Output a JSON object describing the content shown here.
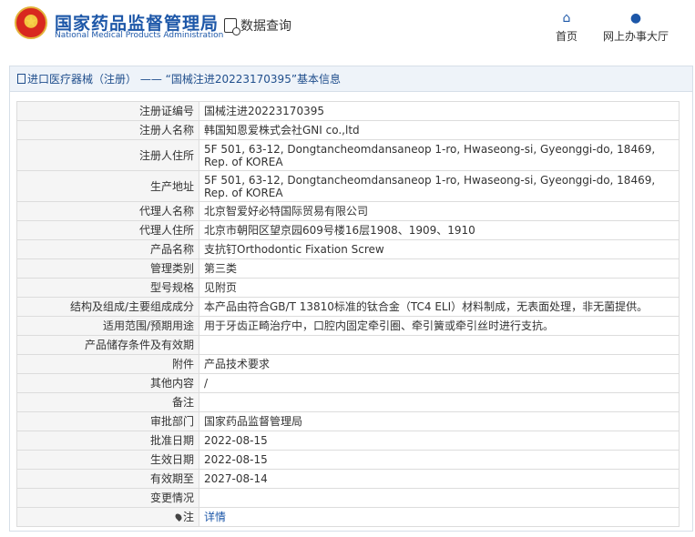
{
  "header": {
    "brand_cn": "国家药品监督管理局",
    "brand_en": "National Medical Products Administration",
    "query_label": "数据查询",
    "nav": [
      {
        "label": "首页",
        "icon": "home-icon"
      },
      {
        "label": "网上办事大厅",
        "icon": "user-icon"
      }
    ]
  },
  "panel": {
    "title": "进口医疗器械（注册） —— “国械注进20223170395”基本信息",
    "rows": [
      {
        "label": "注册证编号",
        "value": "国械注进20223170395"
      },
      {
        "label": "注册人名称",
        "value": "韩国知恩爱株式会社GNI co.,ltd"
      },
      {
        "label": "注册人住所",
        "value": "5F 501, 63-12, Dongtancheomdansaneop 1-ro, Hwaseong-si, Gyeonggi-do, 18469, Rep. of KOREA"
      },
      {
        "label": "生产地址",
        "value": "5F 501, 63-12, Dongtancheomdansaneop 1-ro, Hwaseong-si, Gyeonggi-do, 18469, Rep. of KOREA"
      },
      {
        "label": "代理人名称",
        "value": "北京智爱好必特国际贸易有限公司"
      },
      {
        "label": "代理人住所",
        "value": "北京市朝阳区望京园609号楼16层1908、1909、1910"
      },
      {
        "label": "产品名称",
        "value": "支抗钉Orthodontic Fixation Screw"
      },
      {
        "label": "管理类别",
        "value": "第三类"
      },
      {
        "label": "型号规格",
        "value": "见附页"
      },
      {
        "label": "结构及组成/主要组成成分",
        "value": "本产品由符合GB/T 13810标准的钛合金（TC4 ELI）材料制成，无表面处理，非无菌提供。"
      },
      {
        "label": "适用范围/预期用途",
        "value": "用于牙齿正畸治疗中，口腔内固定牵引圈、牵引簧或牵引丝时进行支抗。"
      },
      {
        "label": "产品储存条件及有效期",
        "value": ""
      },
      {
        "label": "附件",
        "value": "产品技术要求"
      },
      {
        "label": "其他内容",
        "value": "/"
      },
      {
        "label": "备注",
        "value": ""
      },
      {
        "label": "审批部门",
        "value": "国家药品监督管理局"
      },
      {
        "label": "批准日期",
        "value": "2022-08-15"
      },
      {
        "label": "生效日期",
        "value": "2022-08-15"
      },
      {
        "label": "有效期至",
        "value": "2027-08-14"
      },
      {
        "label": "变更情况",
        "value": ""
      }
    ],
    "note_label": "注",
    "note_link": "详情"
  }
}
